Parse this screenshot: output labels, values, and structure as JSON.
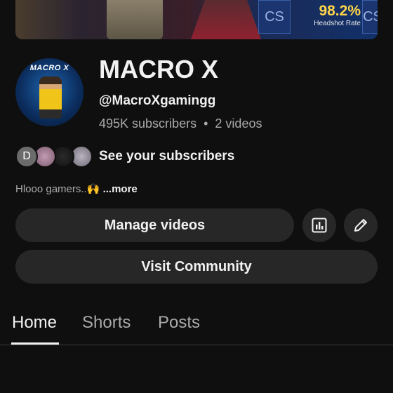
{
  "banner": {
    "cs_left": "CS",
    "cs_right": "CS",
    "headshot_value": "98.2%",
    "headshot_label": "Headshot Rate"
  },
  "avatar": {
    "logo_text": "MACRO X"
  },
  "channel": {
    "name": "MACRO X",
    "handle": "@MacroXgamingg",
    "subscribers": "495K subscribers",
    "separator": "•",
    "videos": "2 videos"
  },
  "subscribers_row": {
    "avatars": [
      {
        "initial": "D",
        "color": "#6b6b6b"
      },
      {
        "initial": "",
        "color": "#a07c92"
      },
      {
        "initial": "",
        "color": "#1a1a1a"
      },
      {
        "initial": "",
        "color": "#9a96a2"
      }
    ],
    "label": "See your subscribers"
  },
  "description": {
    "text": "Hlooo gamers..🙌",
    "more": "...more"
  },
  "buttons": {
    "manage_videos": "Manage videos",
    "analytics_icon": "analytics-icon",
    "edit_icon": "pencil-icon",
    "visit_community": "Visit Community"
  },
  "tabs": [
    {
      "label": "Home",
      "active": true
    },
    {
      "label": "Shorts",
      "active": false
    },
    {
      "label": "Posts",
      "active": false
    }
  ]
}
